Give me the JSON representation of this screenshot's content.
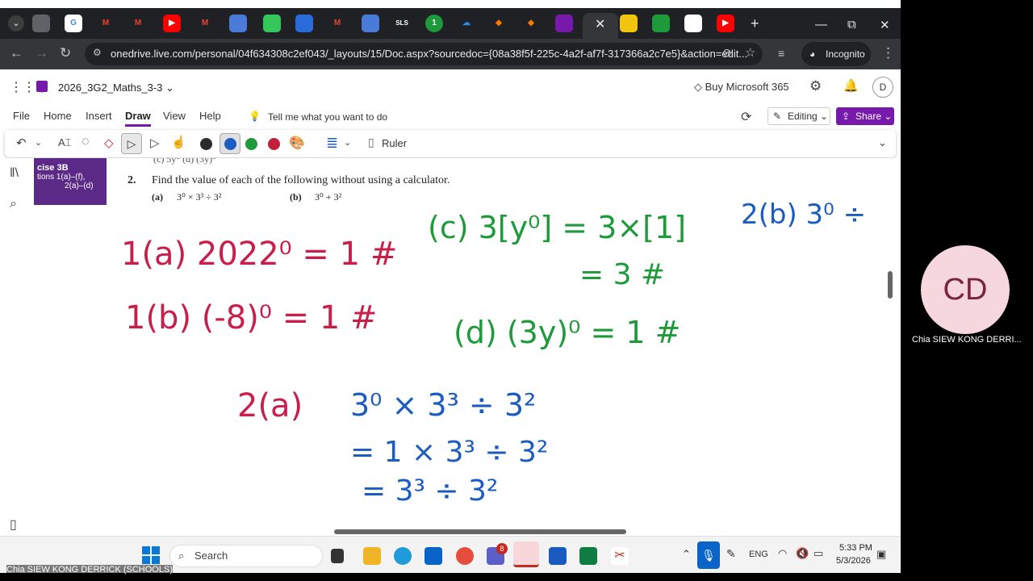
{
  "browser": {
    "tabs": [
      "G",
      "M",
      "▶",
      "M",
      "◘",
      "G",
      "M",
      "◘",
      "SLS",
      "1",
      "☁",
      "◆",
      "M",
      "◆",
      "▶"
    ],
    "address": "onedrive.live.com/personal/04f634308c2ef043/_layouts/15/Doc.aspx?sourcedoc={08a38f5f-225c-4a2f-af7f-317366a2c7e5}&action=edit...",
    "incognito_label": "Incognito"
  },
  "onenote": {
    "notebook_name": "2026_3G2_Maths_3-3",
    "buy_label": "Buy Microsoft 365",
    "user_initial": "D",
    "menu": [
      "File",
      "Home",
      "Insert",
      "Draw",
      "View",
      "Help"
    ],
    "active_menu": "Draw",
    "tellme": "Tell me what you want to do",
    "editing_label": "Editing",
    "share_label": "Share",
    "ruler_label": "Ruler",
    "pen_colors": [
      "#2b2b2b",
      "#1c5bbf",
      "#1e9a3a",
      "#c0203a"
    ]
  },
  "page": {
    "exercise_lines": [
      "cise 3B",
      "tions 1(a)–(f),",
      "2(a)–(d)"
    ],
    "cut_off_row": "(c)  5y⁰                (d)  (3y)⁰",
    "question_number": "2.",
    "question_text": "Find the value of each of the following without using a calculator.",
    "part_a_label": "(a)",
    "part_a": "3⁰ × 3³ ÷ 3²",
    "part_b_label": "(b)",
    "part_b": "3⁰ + 3²",
    "handwriting": {
      "red": [
        "1(a)  2022⁰ = 1 #",
        "1(b)  (-8)⁰ = 1 #",
        "2(a)"
      ],
      "green": [
        "(c)  3[y⁰] = 3×[1]",
        "= 3 #",
        "(d)  (3y)⁰ = 1 #"
      ],
      "blue": [
        "2(b)  3⁰ ÷",
        "3⁰ × 3³ ÷ 3²",
        "= 1 × 3³ ÷ 3²",
        "= 3³ ÷ 3²"
      ]
    }
  },
  "taskbar": {
    "search_label": "Search",
    "lang": "ENG",
    "time": "5:33 PM",
    "date": "5/3/2026",
    "chrome_badge": "8"
  },
  "meeting": {
    "participant_initials": "CD",
    "participant_name": "Chia SIEW KONG DERRI...",
    "sharer_name": "Chia SIEW KONG DERRICK (SCHOOLS)"
  }
}
